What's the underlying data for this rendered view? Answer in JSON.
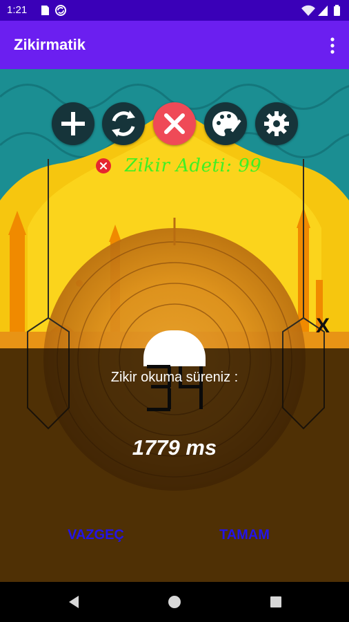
{
  "status_bar": {
    "time": "1:21",
    "left_icons": [
      "sd-card-icon",
      "sync-icon"
    ],
    "right_icons": [
      "wifi-icon",
      "signal-icon",
      "battery-icon"
    ]
  },
  "app_bar": {
    "title": "Zikirmatik",
    "overflow_icon": "more-vertical-icon"
  },
  "toolbar": {
    "buttons": [
      {
        "icon": "plus-icon"
      },
      {
        "icon": "refresh-icon"
      },
      {
        "icon": "close-icon"
      },
      {
        "icon": "palette-icon"
      },
      {
        "icon": "gear-icon"
      }
    ]
  },
  "counter": {
    "label": "Zikir Adeti: 99",
    "remove_icon": "close-circle-icon"
  },
  "side_close": "X",
  "digital_display": "34",
  "dialog": {
    "message": "Zikir okuma süreniz :",
    "value": "1779 ms",
    "cancel_label": "VAZGEÇ",
    "ok_label": "TAMAM"
  },
  "nav_bar": {
    "icons": [
      "back-icon",
      "home-icon",
      "recents-icon"
    ]
  },
  "colors": {
    "status_bar": "#3a00b8",
    "app_bar": "#6b1ff0",
    "accent_green": "#3ff023",
    "dialog_button": "#2414e6",
    "sky_teal": "#1b8e92",
    "sky_yellow": "#f6c60f",
    "counter_close": "#e6262f"
  }
}
